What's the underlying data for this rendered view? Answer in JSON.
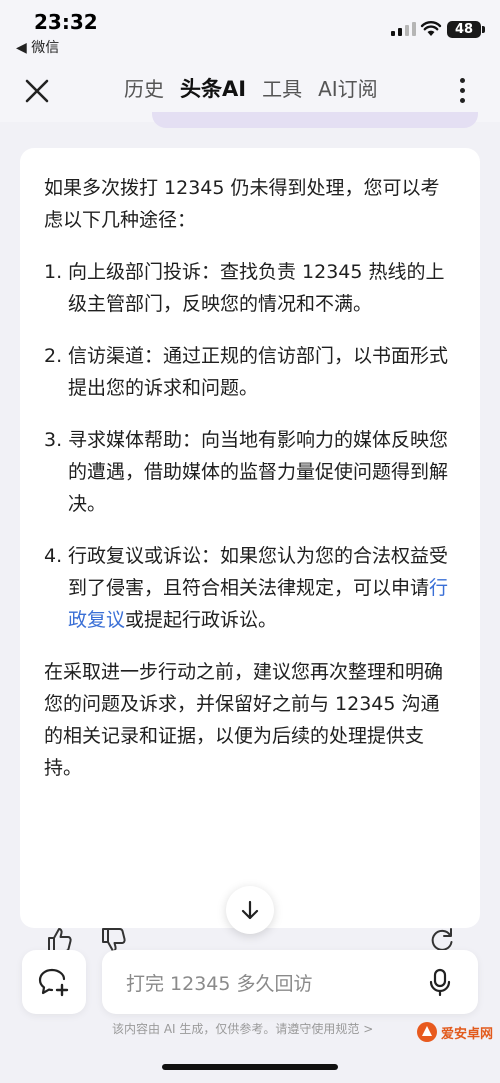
{
  "status_bar": {
    "time": "23:32",
    "back_app": "◀ 微信",
    "battery": "48"
  },
  "nav": {
    "tabs": [
      {
        "label": "历史",
        "active": false
      },
      {
        "label": "头条AI",
        "active": true
      },
      {
        "label": "工具",
        "active": false
      },
      {
        "label": "AI订阅",
        "active": false
      }
    ]
  },
  "answer": {
    "intro": "如果多次拨打 12345 仍未得到处理，您可以考虑以下几种途径：",
    "items": [
      {
        "num": "1.",
        "text": "向上级部门投诉：查找负责 12345 热线的上级主管部门，反映您的情况和不满。"
      },
      {
        "num": "2.",
        "text": "信访渠道：通过正规的信访部门，以书面形式提出您的诉求和问题。"
      },
      {
        "num": "3.",
        "text": "寻求媒体帮助：向当地有影响力的媒体反映您的遭遇，借助媒体的监督力量促使问题得到解决。"
      },
      {
        "num": "4.",
        "text_before": "行政复议或诉讼：如果您认为您的合法权益受到了侵害，且符合相关法律规定，可以申请",
        "link": "行政复议",
        "text_after": "或提起行政诉讼。"
      }
    ],
    "conclusion": "在采取进一步行动之前，建议您再次整理和明确您的问题及诉求，并保留好之前与 12345 沟通的相关记录和证据，以便为后续的处理提供支持。"
  },
  "input": {
    "placeholder": "打完 12345 多久回访"
  },
  "footer": {
    "disclaimer": "该内容由 AI 生成，仅供参考。请遵守使用规范 >",
    "watermark": "爱安卓网"
  },
  "colors": {
    "background": "#f1f1f6",
    "card": "#ffffff",
    "link": "#3a6fd6",
    "prev_bubble": "#e4dff3"
  }
}
